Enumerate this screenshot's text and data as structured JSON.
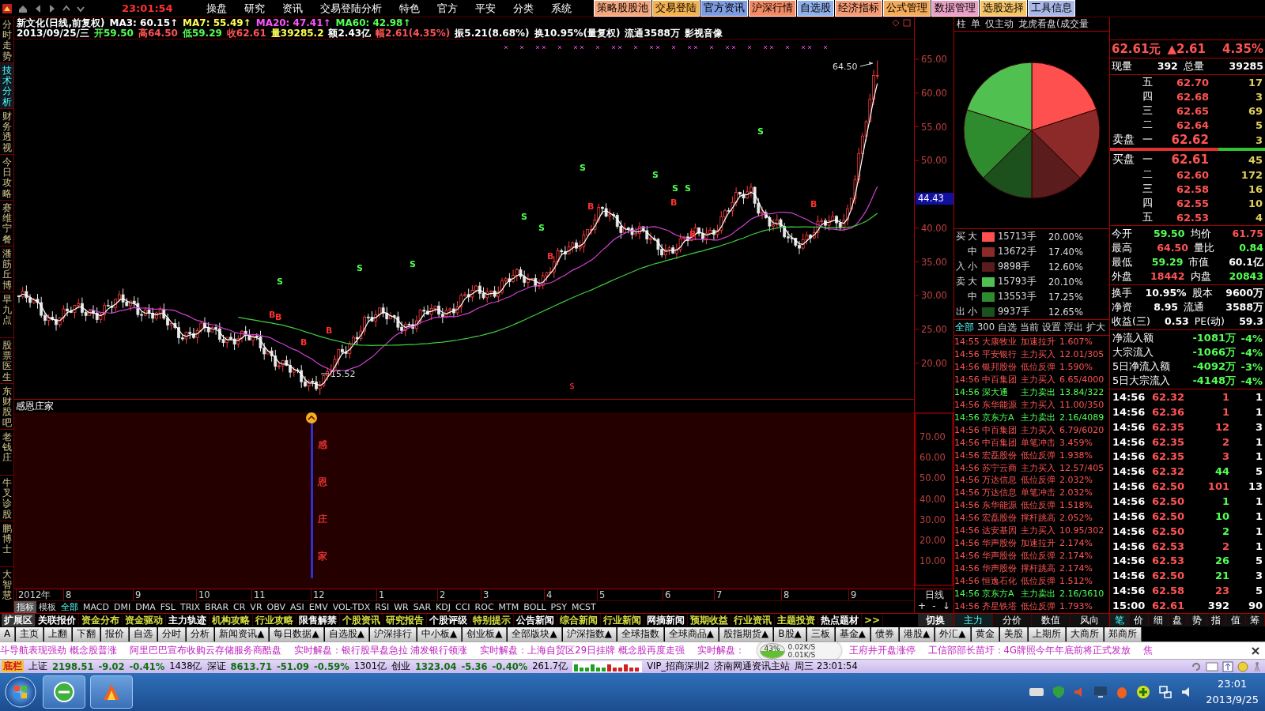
{
  "menu_bar": {
    "clock": "23:01:54",
    "menus": [
      "操盘",
      "研究",
      "资讯",
      "交易登陆分析",
      "特色",
      "官方",
      "平安",
      "分类",
      "系统"
    ],
    "buttons": [
      {
        "label": "策略股股池",
        "color": "#f4a67c"
      },
      {
        "label": "交易登陆",
        "color": "#f5b24e"
      },
      {
        "label": "官方资讯",
        "color": "#7d9be0"
      },
      {
        "label": "沪深行情",
        "color": "#f28a64"
      },
      {
        "label": "自选股",
        "color": "#8fb0ea"
      },
      {
        "label": "经济指标",
        "color": "#f39a74"
      },
      {
        "label": "公式管理",
        "color": "#f5ac5a"
      },
      {
        "label": "数据管理",
        "color": "#e9a2c6"
      },
      {
        "label": "选股选择",
        "color": "#f5c466"
      },
      {
        "label": "工具信息",
        "color": "#a9b8e8"
      }
    ]
  },
  "side_tabs": [
    {
      "label": "分时走势",
      "selected": false
    },
    {
      "label": "技术分析",
      "selected": true
    },
    {
      "label": "财务透视",
      "selected": false
    },
    {
      "label": "今日攻略",
      "selected": false
    },
    {
      "label": "赛维宁餐",
      "selected": false
    },
    {
      "label": "潘筋丘博",
      "selected": false
    },
    {
      "label": "早九点",
      "selected": false
    },
    {
      "label": "股票医生",
      "selected": false
    },
    {
      "label": "东财股吧",
      "selected": false
    },
    {
      "label": "老钱庄",
      "selected": false
    },
    {
      "label": "牛叉诊股",
      "selected": false
    },
    {
      "label": "鹏博士",
      "selected": false
    },
    {
      "label": "大智慧",
      "selected": false
    }
  ],
  "quote_header": {
    "title_items": [
      {
        "text": "新文化(日线,前复权)",
        "color": "#ffffff"
      },
      {
        "text": "MA3: 60.15↑",
        "color": "#ffffff"
      },
      {
        "text": "MA7: 55.49↑",
        "color": "#ffff54"
      },
      {
        "text": "MA20: 47.41↑",
        "color": "#ff54ff"
      },
      {
        "text": "MA60: 42.98↑",
        "color": "#54ff54"
      }
    ],
    "detail_items": [
      {
        "text": "2013/09/25/三",
        "color": "#ffffff"
      },
      {
        "text": "开59.50",
        "color": "#54ff54"
      },
      {
        "text": "高64.50",
        "color": "#ff5454"
      },
      {
        "text": "低59.29",
        "color": "#54ff54"
      },
      {
        "text": "收62.61",
        "color": "#ff5454"
      },
      {
        "text": "量39285.2",
        "color": "#ffff54"
      },
      {
        "text": "额2.43亿",
        "color": "#ffffff"
      },
      {
        "text": "幅2.61(4.35%)",
        "color": "#ff5454"
      },
      {
        "text": "振5.21(8.68%)",
        "color": "#ffffff"
      },
      {
        "text": "换10.95%(量复权)",
        "color": "#ffffff"
      },
      {
        "text": "流通3588万",
        "color": "#ffffff"
      },
      {
        "text": "影视音像",
        "color": "#ffffff"
      }
    ]
  },
  "main_chart": {
    "price_labels": [
      "65.00",
      "60.00",
      "55.00",
      "50.00",
      "40.00",
      "35.00",
      "30.00",
      "25.00",
      "20.00"
    ],
    "cursor_price": "44.43",
    "high_label": "64.50",
    "low_label": "15.52",
    "special_mark": "$",
    "signals": [
      "S",
      "S",
      "S",
      "S",
      "S",
      "S",
      "S",
      "S",
      "S",
      "S",
      "B",
      "B",
      "B",
      "B",
      "B",
      "B",
      "B",
      "B",
      "B"
    ]
  },
  "sub_chart": {
    "title": "感恩庄家",
    "marker_chars": [
      "感",
      "恩",
      "庄",
      "家"
    ],
    "axis_labels": [
      "70.00",
      "60.00",
      "50.00",
      "40.00",
      "30.00",
      "20.00",
      "10.00"
    ]
  },
  "date_axis": [
    "2012年",
    "8",
    "9",
    "10",
    "11",
    "12",
    "1",
    "2",
    "3",
    "4",
    "5",
    "6",
    "7",
    "8",
    "9"
  ],
  "period_label": "日线",
  "zoom_controls": [
    "+",
    "-",
    "↓"
  ],
  "mode_tabs": [
    {
      "label": "指标",
      "selected": true
    },
    {
      "label": "模板",
      "selected": false
    }
  ],
  "indicators": [
    {
      "label": "全部",
      "selected": true
    },
    {
      "label": "MACD",
      "selected": false
    },
    {
      "label": "DMI",
      "selected": false
    },
    {
      "label": "DMA",
      "selected": false
    },
    {
      "label": "FSL",
      "selected": false
    },
    {
      "label": "TRIX",
      "selected": false
    },
    {
      "label": "BRAR",
      "selected": false
    },
    {
      "label": "CR",
      "selected": false
    },
    {
      "label": "VR",
      "selected": false
    },
    {
      "label": "OBV",
      "selected": false
    },
    {
      "label": "ASI",
      "selected": false
    },
    {
      "label": "EMV",
      "selected": false
    },
    {
      "label": "VOL-TDX",
      "selected": false
    },
    {
      "label": "RSI",
      "selected": false
    },
    {
      "label": "WR",
      "selected": false
    },
    {
      "label": "SAR",
      "selected": false
    },
    {
      "label": "KDJ",
      "selected": false
    },
    {
      "label": "CCI",
      "selected": false
    },
    {
      "label": "ROC",
      "selected": false
    },
    {
      "label": "MTM",
      "selected": false
    },
    {
      "label": "BOLL",
      "selected": false
    },
    {
      "label": "PSY",
      "selected": false
    },
    {
      "label": "MCST",
      "selected": false
    }
  ],
  "flow_panel": {
    "header_tabs": [
      "柱",
      "单",
      "仅主动",
      "龙虎看盘(成交量"
    ],
    "chart_data": {
      "type": "pie",
      "values": [
        20.0,
        17.4,
        12.6,
        12.65,
        17.25,
        20.1
      ]
    },
    "legend": [
      {
        "side": "买",
        "size": "大",
        "volume": "15713手",
        "percent": "20.00%",
        "color": "#ff5050"
      },
      {
        "size": "中",
        "volume": "13672手",
        "percent": "17.40%",
        "color": "#8c2a2a"
      },
      {
        "side": "入",
        "size": "小",
        "volume": "9898手",
        "percent": "12.60%",
        "color": "#5a1c1c"
      },
      {
        "side": "卖",
        "size": "大",
        "volume": "15793手",
        "percent": "20.10%",
        "color": "#50c050"
      },
      {
        "size": "中",
        "volume": "13553手",
        "percent": "17.25%",
        "color": "#2e8c2e"
      },
      {
        "side": "出",
        "size": "小",
        "volume": "9937手",
        "percent": "12.65%",
        "color": "#1c501c"
      }
    ],
    "filter_tabs": [
      {
        "label": "全部",
        "selected": true
      },
      {
        "label": "300",
        "selected": false
      },
      {
        "label": "自选",
        "selected": false
      },
      {
        "label": "当前",
        "selected": false
      },
      {
        "label": "设置",
        "selected": false
      },
      {
        "label": "浮出",
        "selected": false
      },
      {
        "label": "扩大",
        "selected": false
      }
    ],
    "signals": [
      {
        "time": "14:55",
        "stock": "大康牧业",
        "signal": "加速拉升",
        "value": "1.607%",
        "color": "#ff5454"
      },
      {
        "time": "14:56",
        "stock": "平安银行",
        "signal": "主力买入",
        "value": "12.01/305",
        "color": "#ff5454"
      },
      {
        "time": "14:56",
        "stock": "银邦股份",
        "signal": "低位反弹",
        "value": "1.590%",
        "color": "#ff5454"
      },
      {
        "time": "14:56",
        "stock": "中百集团",
        "signal": "主力买入",
        "value": "6.65/4000",
        "color": "#ff5454"
      },
      {
        "time": "14:56",
        "stock": "深大通",
        "signal": "主力卖出",
        "value": "13.84/322",
        "color": "#54ff54"
      },
      {
        "time": "14:56",
        "stock": "东华能源",
        "signal": "主力买入",
        "value": "11.00/350",
        "color": "#ff5454"
      },
      {
        "time": "14:56",
        "stock": "京东方A",
        "signal": "主力卖出",
        "value": "2.16/4089",
        "color": "#54ff54"
      },
      {
        "time": "14:56",
        "stock": "中百集团",
        "signal": "主力买入",
        "value": "6.79/6020",
        "color": "#ff5454"
      },
      {
        "time": "14:56",
        "stock": "中百集团",
        "signal": "单笔冲击",
        "value": "3.459%",
        "color": "#ff5454"
      },
      {
        "time": "14:56",
        "stock": "宏磊股份",
        "signal": "低位反弹",
        "value": "1.938%",
        "color": "#ff5454"
      },
      {
        "time": "14:56",
        "stock": "苏宁云商",
        "signal": "主力买入",
        "value": "12.57/405",
        "color": "#ff5454"
      },
      {
        "time": "14:56",
        "stock": "万达信息",
        "signal": "低位反弹",
        "value": "2.032%",
        "color": "#ff5454"
      },
      {
        "time": "14:56",
        "stock": "万达信息",
        "signal": "单笔冲击",
        "value": "2.032%",
        "color": "#ff5454"
      },
      {
        "time": "14:56",
        "stock": "东华能源",
        "signal": "低位反弹",
        "value": "1.518%",
        "color": "#ff5454"
      },
      {
        "time": "14:56",
        "stock": "宏磊股份",
        "signal": "撑杆跳高",
        "value": "2.052%",
        "color": "#ff5454"
      },
      {
        "time": "14:56",
        "stock": "达安基因",
        "signal": "主力买入",
        "value": "10.95/302",
        "color": "#ff5454"
      },
      {
        "time": "14:56",
        "stock": "华声股份",
        "signal": "加速拉升",
        "value": "2.174%",
        "color": "#ff5454"
      },
      {
        "time": "14:56",
        "stock": "华声股份",
        "signal": "低位反弹",
        "value": "2.174%",
        "color": "#ff5454"
      },
      {
        "time": "14:56",
        "stock": "华声股份",
        "signal": "撑杆跳高",
        "value": "2.174%",
        "color": "#ff5454"
      },
      {
        "time": "14:56",
        "stock": "恒逸石化",
        "signal": "低位反弹",
        "value": "1.512%",
        "color": "#ff5454"
      },
      {
        "time": "14:56",
        "stock": "京东方A",
        "signal": "主力卖出",
        "value": "2.16/3610",
        "color": "#54ff54"
      },
      {
        "time": "14:56",
        "stock": "齐星铁塔",
        "signal": "低位反弹",
        "value": "1.793%",
        "color": "#ff5454"
      }
    ]
  },
  "quote_panel": {
    "price": "62.61元",
    "change": "▲2.61",
    "percent": "4.35%",
    "volume": [
      {
        "label": "现量",
        "value": "392"
      },
      {
        "label": "总量",
        "value": "39285"
      }
    ],
    "sell": [
      {
        "level": "五",
        "price": "62.70",
        "qty": "17"
      },
      {
        "level": "四",
        "price": "62.68",
        "qty": "3"
      },
      {
        "level": "三",
        "price": "62.65",
        "qty": "69"
      },
      {
        "level": "二",
        "price": "62.64",
        "qty": "5"
      },
      {
        "side": "卖盘",
        "level": "一",
        "price": "62.62",
        "qty": "3"
      }
    ],
    "balance": {
      "level": 0.7
    },
    "buy": [
      {
        "side": "买盘",
        "level": "一",
        "price": "62.61",
        "qty": "45"
      },
      {
        "level": "二",
        "price": "62.60",
        "qty": "172"
      },
      {
        "level": "三",
        "price": "62.58",
        "qty": "16"
      },
      {
        "level": "四",
        "price": "62.55",
        "qty": "10"
      },
      {
        "level": "五",
        "price": "62.53",
        "qty": "4"
      }
    ],
    "stats": [
      {
        "label": "今开",
        "value": "59.50",
        "color": "#54ff54"
      },
      {
        "label": "均价",
        "value": "61.75",
        "color": "#ff5454"
      },
      {
        "label": "最高",
        "value": "64.50",
        "color": "#ff5454"
      },
      {
        "label": "量比",
        "value": "0.84",
        "color": "#54ff54"
      },
      {
        "label": "最低",
        "value": "59.29",
        "color": "#54ff54"
      },
      {
        "label": "市值",
        "value": "60.1亿",
        "color": "#ffffff"
      },
      {
        "label": "外盘",
        "value": "18442",
        "color": "#ff5454"
      },
      {
        "label": "内盘",
        "value": "20843",
        "color": "#54ff54"
      }
    ],
    "finance": [
      {
        "label": "换手",
        "value": "10.95%"
      },
      {
        "label": "股本",
        "value": "9600万"
      },
      {
        "label": "净资",
        "value": "8.95"
      },
      {
        "label": "流通",
        "value": "3588万"
      },
      {
        "label": "收益(三)",
        "value": "0.53"
      },
      {
        "label": "PE(动)",
        "value": "59.3"
      }
    ],
    "flows": [
      {
        "label": "净流入额",
        "value": "-1081万",
        "percent": "-4%"
      },
      {
        "label": "大宗流入",
        "value": "-1066万",
        "percent": "-4%"
      },
      {
        "label": "5日净流入额",
        "value": "-4092万",
        "percent": "-3%"
      },
      {
        "label": "5日大宗流入",
        "value": "-4148万",
        "percent": "-4%"
      }
    ],
    "ticks": [
      {
        "time": "14:56",
        "price": "62.32",
        "volume": "1",
        "count": "1",
        "color": "#ff5454"
      },
      {
        "time": "14:56",
        "price": "62.36",
        "volume": "1",
        "count": "1",
        "color": "#ff5454"
      },
      {
        "time": "14:56",
        "price": "62.35",
        "volume": "12",
        "count": "3",
        "color": "#ff5454"
      },
      {
        "time": "14:56",
        "price": "62.35",
        "volume": "2",
        "count": "1",
        "color": "#ff5454"
      },
      {
        "time": "14:56",
        "price": "62.35",
        "volume": "3",
        "count": "1",
        "color": "#ff5454"
      },
      {
        "time": "14:56",
        "price": "62.32",
        "volume": "44",
        "count": "5",
        "color": "#54ff54"
      },
      {
        "time": "14:56",
        "price": "62.50",
        "volume": "101",
        "count": "13",
        "color": "#ff5454"
      },
      {
        "time": "14:56",
        "price": "62.50",
        "volume": "1",
        "count": "1",
        "color": "#54ff54"
      },
      {
        "time": "14:56",
        "price": "62.50",
        "volume": "10",
        "count": "1",
        "color": "#54ff54"
      },
      {
        "time": "14:56",
        "price": "62.50",
        "volume": "2",
        "count": "1",
        "color": "#54ff54"
      },
      {
        "time": "14:56",
        "price": "62.53",
        "volume": "2",
        "count": "1",
        "color": "#ff5454"
      },
      {
        "time": "14:56",
        "price": "62.53",
        "volume": "26",
        "count": "5",
        "color": "#54ff54"
      },
      {
        "time": "14:56",
        "price": "62.50",
        "volume": "21",
        "count": "3",
        "color": "#54ff54"
      },
      {
        "time": "14:56",
        "price": "62.58",
        "volume": "23",
        "count": "5",
        "color": "#ff5454"
      },
      {
        "time": "15:00",
        "price": "62.61",
        "volume": "392",
        "count": "90",
        "color": "#ffffff"
      }
    ]
  },
  "extension_tabs": [
    {
      "label": "扩展区",
      "highlighted": false
    },
    {
      "label": "关联报价",
      "highlighted": false
    },
    {
      "label": "资金分布",
      "highlighted": true
    },
    {
      "label": "资金驱动",
      "highlighted": true
    },
    {
      "label": "主力轨迹",
      "highlighted": false
    },
    {
      "label": "机构攻略",
      "highlighted": true
    },
    {
      "label": "行业攻略",
      "highlighted": true
    },
    {
      "label": "限售解禁",
      "highlighted": false
    },
    {
      "label": "个股资讯",
      "highlighted": true
    },
    {
      "label": "研究报告",
      "highlighted": true
    },
    {
      "label": "个股评级",
      "highlighted": false
    },
    {
      "label": "特别提示",
      "highlighted": true
    },
    {
      "label": "公告新闻",
      "highlighted": false
    },
    {
      "label": "综合新闻",
      "highlighted": true
    },
    {
      "label": "行业新闻",
      "highlighted": true
    },
    {
      "label": "网摘新闻",
      "highlighted": false
    },
    {
      "label": "预期收益",
      "highlighted": true
    },
    {
      "label": "行业资讯",
      "highlighted": true
    },
    {
      "label": "主题投资",
      "highlighted": true
    },
    {
      "label": "热点题材",
      "highlighted": false
    },
    {
      "label": ">>",
      "highlighted": true
    }
  ],
  "switch_button": "切换",
  "flow_tabs": [
    {
      "label": "主力",
      "selected": true
    },
    {
      "label": "分价",
      "selected": false
    },
    {
      "label": "数值",
      "selected": false
    },
    {
      "label": "风向",
      "selected": false
    }
  ],
  "quote_tabs": [
    {
      "label": "笔",
      "selected": true
    },
    {
      "label": "价",
      "selected": false
    },
    {
      "label": "细",
      "selected": false
    },
    {
      "label": "盘",
      "selected": false
    },
    {
      "label": "势",
      "selected": false
    },
    {
      "label": "指",
      "selected": false
    },
    {
      "label": "值",
      "selected": false
    },
    {
      "label": "筹",
      "selected": false
    }
  ],
  "nav_bar": [
    "A",
    "主页",
    "上翻",
    "下翻",
    "报价",
    "自选",
    "分时",
    "分析",
    "新闻资讯▲",
    "每日数据▲",
    "自选股▲",
    "沪深排行",
    "中小板▲",
    "创业板▲",
    "全部版块▲",
    "沪深指数▲",
    "全球指数",
    "全球商品▲",
    "股指期货▲",
    "B股▲",
    "三板",
    "基金▲",
    "债券",
    "港股▲",
    "外汇▲",
    "黄金",
    "美股",
    "上期所",
    "大商所",
    "郑商所"
  ],
  "ticker": {
    "before": [
      "斗导航表现强劲  概念股普涨",
      "阿里巴巴宣布收购云存储服务商酷盘",
      "实时解盘：银行股早盘急拉  浦发银行领涨",
      "实时解盘：上海自贸区29日挂牌  概念股再度走强",
      "实时解盘："
    ],
    "after": [
      "王府井开盘涨停",
      "工信部部长苗圩：4G牌照今年年底前将正式发放",
      "焦"
    ]
  },
  "speed_widget": {
    "percent": "43%",
    "upload": "0.02K/S",
    "download": "0.01K/S"
  },
  "status_bar": {
    "label": "底栏",
    "indices": [
      {
        "name": "上证",
        "value": "2198.51",
        "change": "-9.02",
        "percent": "-0.41%",
        "amount": "1438亿"
      },
      {
        "name": "深证",
        "value": "8613.71",
        "change": "-51.09",
        "percent": "-0.59%",
        "amount": "1301亿"
      },
      {
        "name": "创业",
        "value": "1323.04",
        "change": "-5.36",
        "percent": "-0.40%",
        "amount": "261.7亿"
      }
    ],
    "server": "VIP_招商深圳2",
    "site": "济南网通资讯主站",
    "datetime": "周三 23:01:54"
  },
  "taskbar": {
    "time": "23:01",
    "date": "2013/9/25"
  }
}
